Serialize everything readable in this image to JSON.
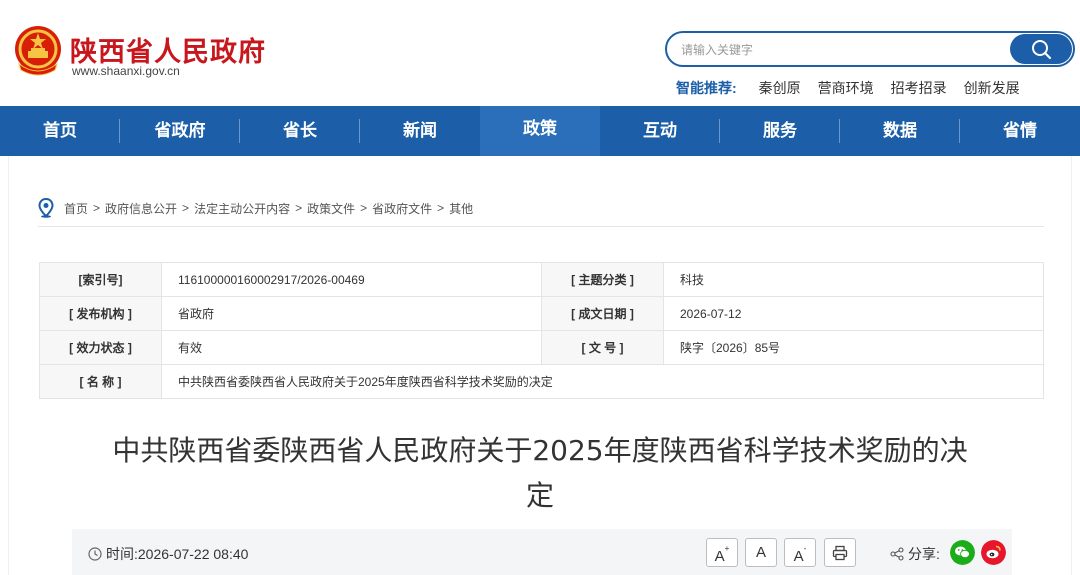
{
  "header": {
    "site_title": "陕西省人民政府",
    "site_url": "www.shaanxi.gov.cn",
    "search_placeholder": "请输入关键字",
    "hot_label": "智能推荐:",
    "hot_links": [
      "秦创原",
      "营商环境",
      "招考招录",
      "创新发展"
    ]
  },
  "nav": {
    "items": [
      "首页",
      "省政府",
      "省长",
      "新闻",
      "政策",
      "互动",
      "服务",
      "数据",
      "省情"
    ],
    "active": "政策"
  },
  "breadcrumb": [
    "首页",
    "政府信息公开",
    "法定主动公开内容",
    "政策文件",
    "省政府文件",
    "其他"
  ],
  "meta": {
    "index_label": "[索引号]",
    "index_value": "116100000160002917/2026-00469",
    "topic_label": "[ 主题分类 ]",
    "topic_value": "科技",
    "issuer_label": "[ 发布机构 ]",
    "issuer_value": "省政府",
    "date_label": "[ 成文日期 ]",
    "date_value": "2026-07-12",
    "status_label": "[ 效力状态 ]",
    "status_value": "有效",
    "docno_label": "[ 文 号 ]",
    "docno_value": "陕字〔2026〕85号",
    "name_label": "[ 名 称 ]",
    "name_value": "中共陕西省委陕西省人民政府关于2025年度陕西省科学技术奖励的决定"
  },
  "article": {
    "title_line1": "中共陕西省委陕西省人民政府关于2025年度陕西省科学技术奖励的决",
    "title_line2": "定",
    "time_label": "时间:",
    "time_value": "2026-07-22 08:40",
    "font_buttons": [
      "A",
      "A",
      "A"
    ],
    "share_label": "分享:"
  },
  "colors": {
    "brand_red": "#c8161d",
    "nav_blue": "#1c5fa8",
    "wechat_green": "#1aad19",
    "weibo_red": "#e6162d"
  },
  "icons": [
    "national-emblem-icon",
    "search-icon",
    "location-pin-icon",
    "clock-icon",
    "print-icon",
    "share-icon",
    "wechat-icon",
    "weibo-icon"
  ]
}
